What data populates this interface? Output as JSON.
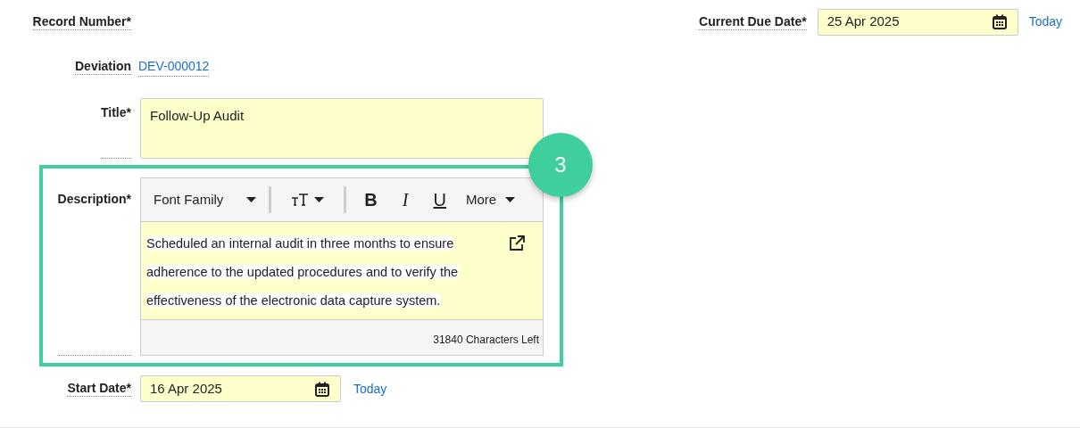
{
  "record_number": {
    "label": "Record Number*"
  },
  "current_due_date": {
    "label": "Current Due Date*",
    "value": "25 Apr 2025",
    "today_link": "Today"
  },
  "deviation": {
    "label": "Deviation",
    "value": "DEV-000012"
  },
  "title": {
    "label": "Title*",
    "value": "Follow-Up Audit"
  },
  "description": {
    "label": "Description*",
    "step_badge": "3",
    "toolbar": [
      {
        "kind": "dropdown",
        "label": "Font Family"
      },
      {
        "kind": "separator"
      },
      {
        "kind": "font-size"
      },
      {
        "kind": "separator"
      },
      {
        "kind": "bold",
        "label": "B"
      },
      {
        "kind": "italic",
        "label": "I"
      },
      {
        "kind": "underline",
        "label": "U"
      },
      {
        "kind": "dropdown",
        "label": "More"
      }
    ],
    "value": "Scheduled an internal audit in three months to ensure adherence to the updated procedures and to verify the effectiveness of the electronic data capture system.",
    "characters_left": "31840 Characters Left"
  },
  "start_date": {
    "label": "Start Date*",
    "value": "16 Apr 2025",
    "today_link": "Today"
  }
}
